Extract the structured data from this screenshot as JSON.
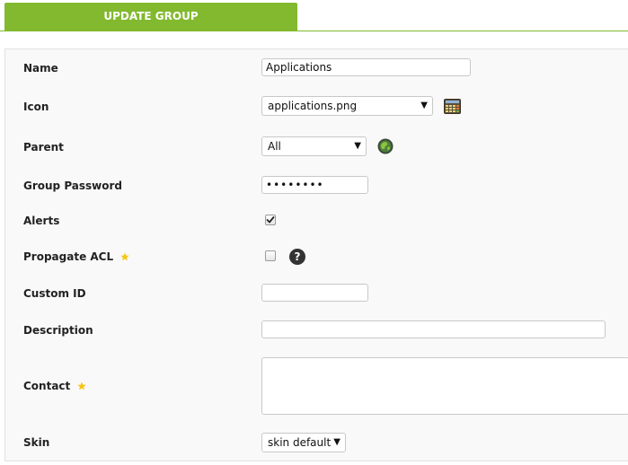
{
  "tab": {
    "label": "UPDATE GROUP"
  },
  "form": {
    "name": {
      "label": "Name",
      "value": "Applications"
    },
    "icon": {
      "label": "Icon",
      "selected": "applications.png"
    },
    "parent": {
      "label": "Parent",
      "selected": "All"
    },
    "group_password": {
      "label": "Group Password",
      "value": "••••••••"
    },
    "alerts": {
      "label": "Alerts",
      "checked": true
    },
    "propagate_acl": {
      "label": "Propagate ACL",
      "checked": false,
      "help_glyph": "?"
    },
    "custom_id": {
      "label": "Custom ID",
      "value": ""
    },
    "description": {
      "label": "Description",
      "value": ""
    },
    "contact": {
      "label": "Contact",
      "value": ""
    },
    "skin": {
      "label": "Skin",
      "selected": "skin default"
    }
  },
  "colors": {
    "accent": "#82b92e",
    "star": "#f5c518",
    "panel_bg": "#f9f9f9"
  }
}
